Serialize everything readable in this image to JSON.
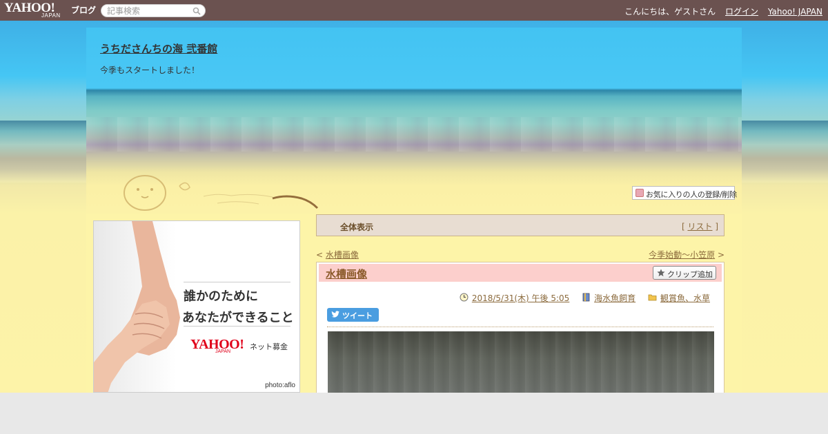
{
  "topbar": {
    "logo": "YAHOO!",
    "logo_sub": "JAPAN",
    "blog_label": "ブログ",
    "search_placeholder": "記事検索",
    "greeting": "こんにちは、ゲストさん",
    "login": "ログイン",
    "yahoo_japan": "Yahoo! JAPAN"
  },
  "header": {
    "blog_title": "うちださんちの海 弐番館",
    "subtitle": "今季もスタートしました！",
    "fav_button": "お気に入りの人の登録/削除"
  },
  "ad": {
    "line1": "誰かのために",
    "line2": "あなたができること",
    "brand": "YAHOO!",
    "brand_sub": "JAPAN",
    "donation": "ネット募金",
    "credit": "photo:aflo"
  },
  "listbar": {
    "title": "全体表示",
    "open": "[ ",
    "link": "リスト",
    "close": " ]"
  },
  "nav": {
    "prev_marker": "< ",
    "prev": "水槽画像",
    "next": "今季始動～小笠原",
    "next_marker": " >"
  },
  "article": {
    "title": "水槽画像",
    "clip_button": "クリップ追加",
    "date": "2018/5/31(木) 午後 5:05",
    "category": "海水魚飼育",
    "folder": "観賞魚、水草",
    "tweet": "ツイート"
  },
  "colors": {
    "topbar": "#6b5250",
    "accent_link": "#8b6a3c",
    "article_header": "#fccfcc",
    "tweet": "#4a9de0"
  }
}
